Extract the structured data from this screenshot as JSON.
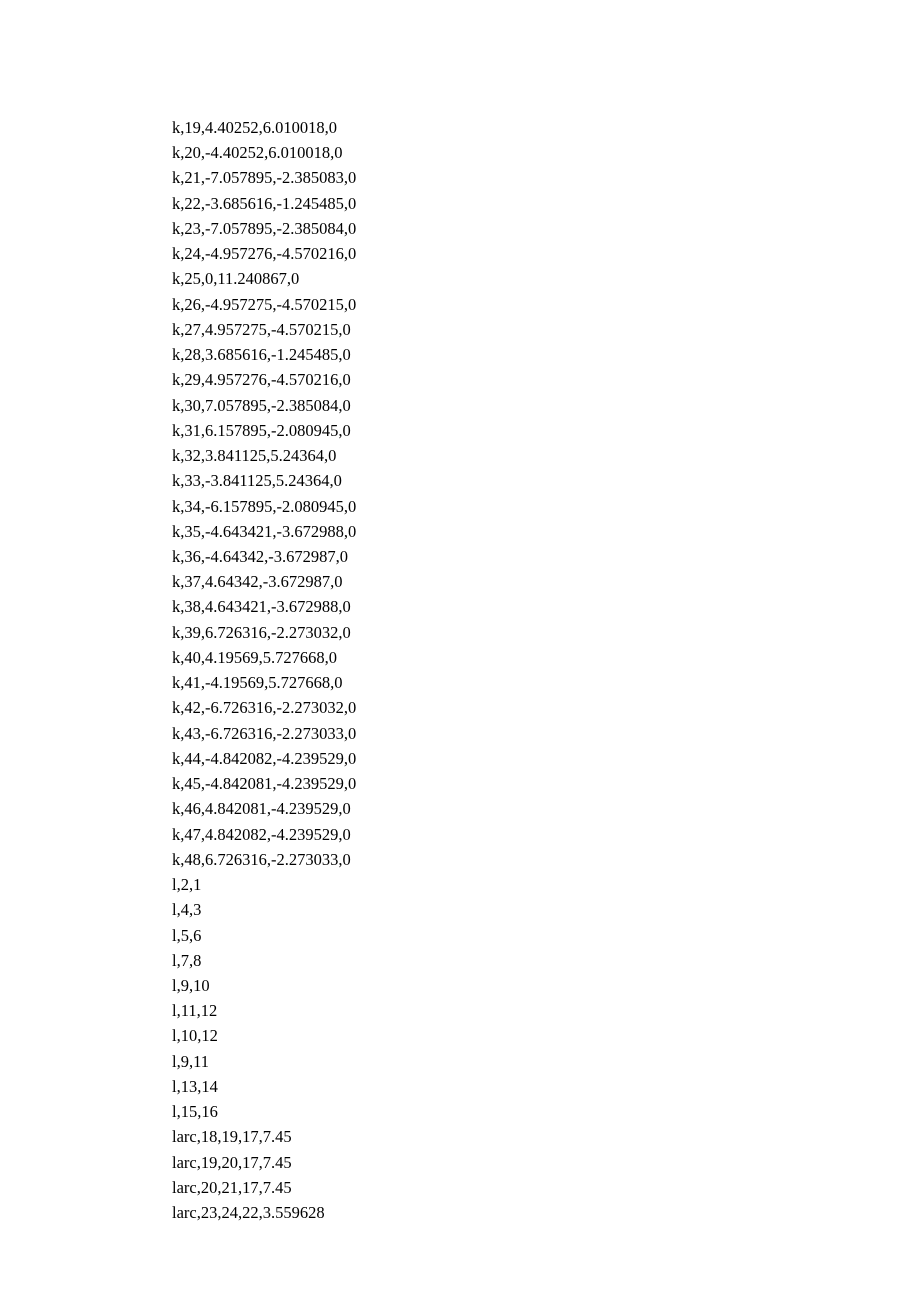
{
  "lines": [
    "k,19,4.40252,6.010018,0",
    "k,20,-4.40252,6.010018,0",
    "k,21,-7.057895,-2.385083,0",
    "k,22,-3.685616,-1.245485,0",
    "k,23,-7.057895,-2.385084,0",
    "k,24,-4.957276,-4.570216,0",
    "k,25,0,11.240867,0",
    "k,26,-4.957275,-4.570215,0",
    "k,27,4.957275,-4.570215,0",
    "k,28,3.685616,-1.245485,0",
    "k,29,4.957276,-4.570216,0",
    "k,30,7.057895,-2.385084,0",
    "k,31,6.157895,-2.080945,0",
    "k,32,3.841125,5.24364,0",
    "k,33,-3.841125,5.24364,0",
    "k,34,-6.157895,-2.080945,0",
    "k,35,-4.643421,-3.672988,0",
    "k,36,-4.64342,-3.672987,0",
    "k,37,4.64342,-3.672987,0",
    "k,38,4.643421,-3.672988,0",
    "k,39,6.726316,-2.273032,0",
    "k,40,4.19569,5.727668,0",
    "k,41,-4.19569,5.727668,0",
    "k,42,-6.726316,-2.273032,0",
    "k,43,-6.726316,-2.273033,0",
    "k,44,-4.842082,-4.239529,0",
    "k,45,-4.842081,-4.239529,0",
    "k,46,4.842081,-4.239529,0",
    "k,47,4.842082,-4.239529,0",
    "k,48,6.726316,-2.273033,0",
    "l,2,1",
    "l,4,3",
    "l,5,6",
    "l,7,8",
    "l,9,10",
    "l,11,12",
    "l,10,12",
    "l,9,11",
    "l,13,14",
    "l,15,16",
    "larc,18,19,17,7.45",
    "larc,19,20,17,7.45",
    "larc,20,21,17,7.45",
    "larc,23,24,22,3.559628"
  ]
}
